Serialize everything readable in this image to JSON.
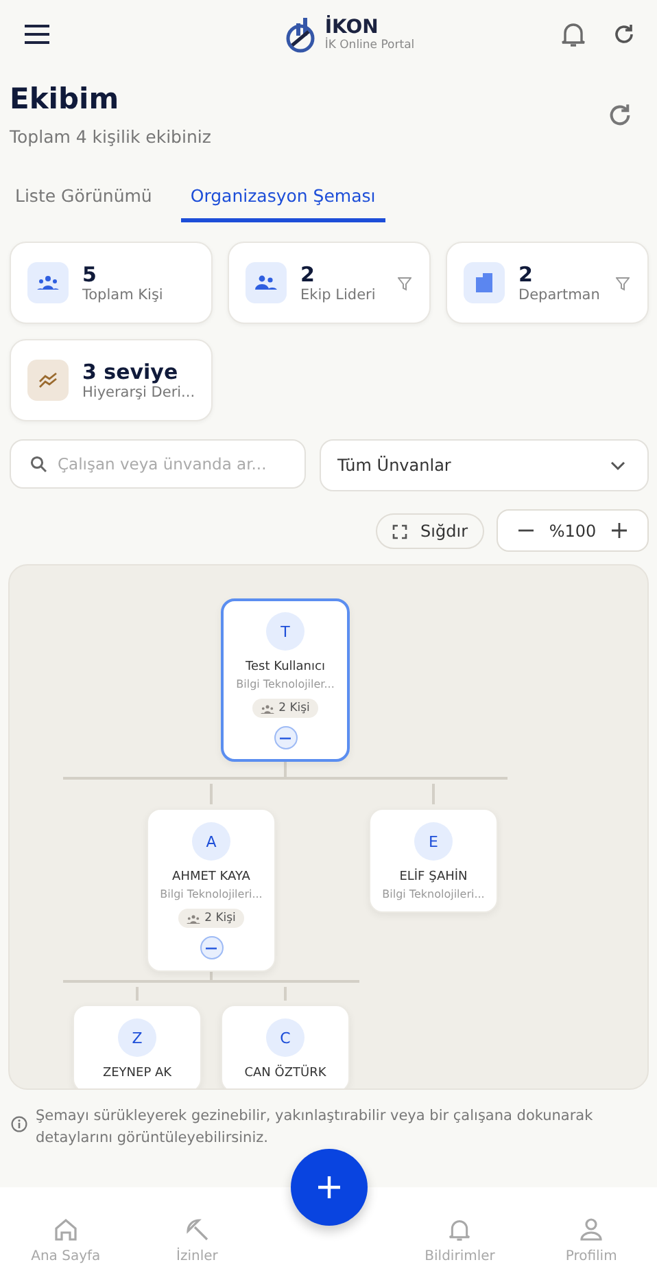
{
  "header": {
    "brand": "İKON",
    "subtitle": "İK Online Portal"
  },
  "page": {
    "title": "Ekibim",
    "subtitle": "Toplam 4 kişilik ekibiniz"
  },
  "tabs": [
    {
      "label": "Liste Görünümü",
      "selected": false
    },
    {
      "label": "Organizasyon Şeması",
      "selected": true
    }
  ],
  "stats": [
    {
      "kind": "people",
      "value": "5",
      "label": "Toplam Kişi",
      "filter": false
    },
    {
      "kind": "leader",
      "value": "2",
      "label": "Ekip Lideri",
      "filter": true
    },
    {
      "kind": "building",
      "value": "2",
      "label": "Departman",
      "filter": true
    },
    {
      "kind": "levels",
      "value": "3 seviye",
      "label": "Hiyerarşi Deri...",
      "filter": false
    }
  ],
  "search": {
    "placeholder": "Çalışan veya ünvanda ar..."
  },
  "title_filter": {
    "value": "Tüm Ünvanlar"
  },
  "zoom": {
    "fit_label": "Sığdır",
    "value": "%100"
  },
  "org_chart": {
    "root": {
      "initial": "T",
      "name": "Test Kullanıcı",
      "department": "Bilgi Teknolojiler...",
      "team": "2 Kişi",
      "expanded": true,
      "selected": true,
      "children": [
        {
          "initial": "A",
          "name": "AHMET KAYA",
          "department": "Bilgi Teknolojileri...",
          "team": "2 Kişi",
          "expanded": true,
          "selected": false,
          "children": [
            {
              "initial": "Z",
              "name": "ZEYNEP AK",
              "selected": false
            },
            {
              "initial": "C",
              "name": "CAN ÖZTÜRK",
              "selected": false
            }
          ]
        },
        {
          "initial": "E",
          "name": "ELİF ŞAHİN",
          "department": "Bilgi Teknolojileri...",
          "selected": false
        }
      ]
    }
  },
  "hint": "Şemayı sürükleyerek gezinebilir, yakınlaştırabilir veya bir çalışana dokunarak detaylarını görüntüleyebilirsiniz.",
  "bottom_nav": [
    {
      "kind": "home",
      "label": "Ana Sayfa",
      "selected": false
    },
    {
      "kind": "leave",
      "label": "İzinler",
      "selected": false
    },
    {
      "kind": "bell",
      "label": "Bildirimler",
      "selected": false
    },
    {
      "kind": "user",
      "label": "Profilim",
      "selected": false
    }
  ]
}
